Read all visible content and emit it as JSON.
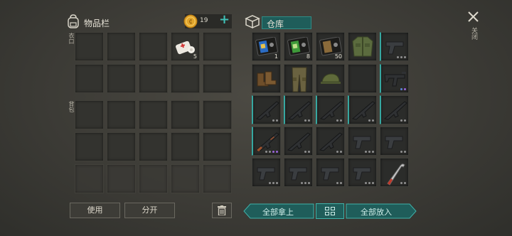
{
  "inventory": {
    "title": "物品栏",
    "coins": "19",
    "add_symbol": "+",
    "sections": {
      "pockets": "衣口",
      "backpack": "背包"
    },
    "items": [
      {
        "name": "first-aid-kit",
        "count": "5"
      }
    ]
  },
  "warehouse": {
    "title": "仓库",
    "close_label": "关闭",
    "items": [
      {
        "icon": "blue-crate-icon",
        "count": "1"
      },
      {
        "icon": "green-crate-icon",
        "count": "8"
      },
      {
        "icon": "book-icon",
        "count": "50"
      },
      {
        "icon": "military-jacket-icon"
      },
      {
        "icon": "pistol-icon",
        "dots": 3
      },
      {
        "icon": "boots-icon"
      },
      {
        "icon": "military-pants-icon"
      },
      {
        "icon": "military-cap-icon"
      },
      {
        "icon": "empty"
      },
      {
        "icon": "smg-icon",
        "dots": 2
      },
      {
        "icon": "assault-rifle-icon"
      },
      {
        "icon": "assault-rifle-icon"
      },
      {
        "icon": "assault-rifle-icon"
      },
      {
        "icon": "assault-rifle-icon"
      },
      {
        "icon": "assault-rifle-icon"
      },
      {
        "icon": "ak-rifle-icon"
      },
      {
        "icon": "assault-rifle-icon"
      },
      {
        "icon": "assault-rifle-icon"
      },
      {
        "icon": "pistol-icon"
      },
      {
        "icon": "pistol-icon"
      },
      {
        "icon": "pistol-icon"
      },
      {
        "icon": "pistol-icon"
      },
      {
        "icon": "pistol-icon"
      },
      {
        "icon": "pistol-icon"
      },
      {
        "icon": "crowbar-icon"
      }
    ]
  },
  "buttons": {
    "use": "使用",
    "split": "分开",
    "take_all": "全部拿上",
    "put_all": "全部放入"
  },
  "colors": {
    "accent": "#3fb1a8",
    "teal_dark": "#1f5d5a",
    "coin": "#e1a42a"
  }
}
